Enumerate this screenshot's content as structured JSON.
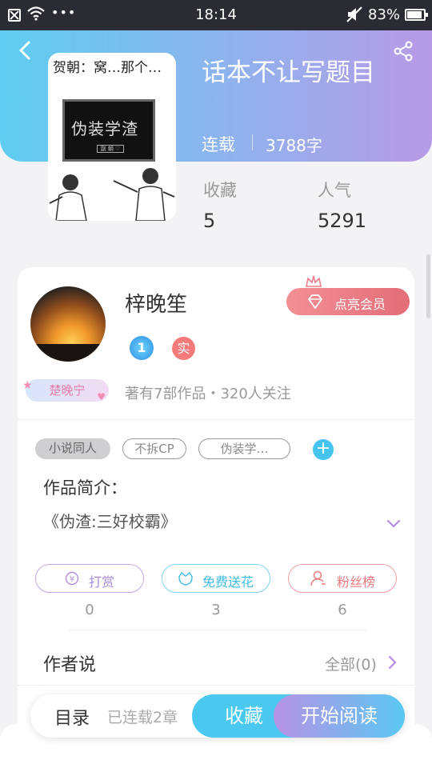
{
  "status_bar": {
    "time": "18:14",
    "battery_pct": "83%",
    "dots": "•••"
  },
  "book": {
    "cover_handwriting": "贺朝：窝…那个…",
    "cover_board_text": "伪装学渣",
    "cover_board_small": "副 朝 ♡",
    "title": "话本不让写题目",
    "status": "连载",
    "word_count": "3788字",
    "stats": [
      {
        "label": "收藏",
        "value": "5"
      },
      {
        "label": "人气",
        "value": "5291"
      }
    ]
  },
  "author": {
    "name": "梓晚笙",
    "vip_label": "点亮会员",
    "badge_level": "1",
    "badge_verified": "实",
    "name_tag": "楚晚宁",
    "meta": "著有7部作品・320人关注"
  },
  "tags": [
    "小说同人",
    "不拆CP",
    "伪装学…"
  ],
  "tag_add_symbol": "+",
  "intro": {
    "title": "作品简介：",
    "text": "《伪渣:三好校霸》"
  },
  "actions": [
    {
      "label": "打赏",
      "count": "0",
      "color": "#b38ee0"
    },
    {
      "label": "免费送花",
      "count": "3",
      "color": "#4cc3ea"
    },
    {
      "label": "粉丝榜",
      "count": "6",
      "color": "#ee7e80"
    }
  ],
  "author_says": {
    "title": "作者说",
    "all_label": "全部(0)"
  },
  "bottom_bar": {
    "toc_label": "目录",
    "chapters_label": "已连载2章",
    "favorite_label": "收藏",
    "read_label": "开始阅读"
  },
  "colors": {
    "header_gradient_start": "#5fcdf1",
    "header_gradient_end": "#b79be6",
    "vip_pink": "#e36d78",
    "accent_blue": "#4ac8ef",
    "accent_purple": "#b792e6"
  }
}
